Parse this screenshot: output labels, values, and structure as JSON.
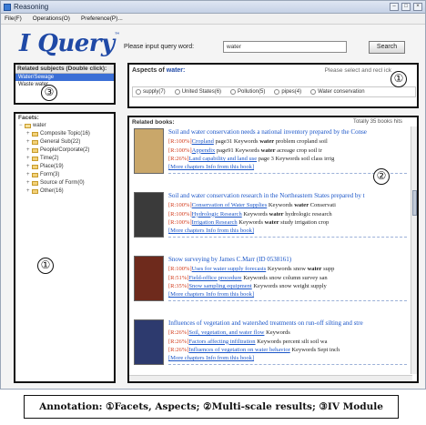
{
  "window": {
    "title": "Reasoning",
    "menu": [
      "File(F)",
      "Operations(O)",
      "Preference(P)..."
    ]
  },
  "header": {
    "logo": "I Query",
    "logo_mark": "™",
    "search_label": "Please input query word:",
    "search_value": "water",
    "search_button": "Search"
  },
  "related": {
    "header": "Related subjects (Double click):",
    "items": [
      "Water/Sewage",
      "Waste water"
    ]
  },
  "facets": {
    "header": "Facets:",
    "root": "water",
    "nodes": [
      "Composite Topic(16)",
      "General Sub(22)",
      "People/Corporate(2)",
      "Time(2)",
      "Place(19)",
      "Form(3)",
      "Source of Form(0)",
      "Other(16)"
    ]
  },
  "aspects": {
    "title_prefix": "Aspects of",
    "keyword": "water:",
    "hint": "Please select and recl ick",
    "options": [
      "supply(7)",
      "United States(6)",
      "Pollution(5)",
      "pipes(4)",
      "Water conservation"
    ]
  },
  "results": {
    "header": "Related books:",
    "count": "Totally 35 books hits",
    "more_label": "[More chapters Info from this book]",
    "books": [
      {
        "title": "Soil and water conservation needs a national inventory prepared by the Conse",
        "cover_color": "#c9a76a",
        "hits": [
          {
            "pct": "[R:100%]",
            "link": "Cropland",
            "text": " page31   Keywords ",
            "kw": "water",
            "rest": "  problem  cropland  soil"
          },
          {
            "pct": "[R:100%]",
            "link": "Appendix",
            "text": " page91   Keywords ",
            "kw": "water",
            "rest": "  acreage  crop  soil  ir"
          },
          {
            "pct": "[R:26%]",
            "link": "Land capability and land use",
            "text": " page 3   Keywords ",
            "kw": "",
            "rest": "soil  class  irrig"
          }
        ]
      },
      {
        "title": "Soil and water conservation research in the Northeastern States prepared by t",
        "cover_color": "#3a3a3a",
        "hits": [
          {
            "pct": "[R:100%]",
            "link": "Conservation of Water Supplies",
            "text": "   Keywords ",
            "kw": "water",
            "rest": "  Conservati"
          },
          {
            "pct": "[R:100%]",
            "link": "Hydrologic Research",
            "text": "   Keywords ",
            "kw": "water",
            "rest": "  hydrologic  research"
          },
          {
            "pct": "[R:100%]",
            "link": "Irrigation Research",
            "text": "   Keywords ",
            "kw": "water",
            "rest": "  study  irrigation  crop"
          }
        ]
      },
      {
        "title": "Snow surveying by James C.Marr (ID 0538161)",
        "cover_color": "#6e2a1c",
        "hits": [
          {
            "pct": "[R:100%]",
            "link": "Uses for water supply forecasts",
            "text": "   Keywords snow ",
            "kw": "water",
            "rest": "  supp"
          },
          {
            "pct": "[R:51%]",
            "link": "Field-office procedure",
            "text": "   Keywords snow  column  survey  san",
            "kw": "",
            "rest": ""
          },
          {
            "pct": "[R:35%]",
            "link": "Snow sampling equipment",
            "text": "   Keywords snow  weight  supply",
            "kw": "",
            "rest": ""
          }
        ]
      },
      {
        "title": "Influences of vegetation and watershed treatments on run-off silting and stre",
        "cover_color": "#2d3a6e",
        "hits": [
          {
            "pct": "[R:26%]",
            "link": "Soil, vegetation, and water flow",
            "text": "   Keywords",
            "kw": "",
            "rest": ""
          },
          {
            "pct": "[R:26%]",
            "link": "Factors affecting infiltration",
            "text": "   Keywords  percent  silt  soil  wa",
            "kw": "",
            "rest": ""
          },
          {
            "pct": "[R:26%]",
            "link": "Influences of vegetation on water behavior",
            "text": "   Keywords Sept  inch",
            "kw": "",
            "rest": ""
          }
        ]
      }
    ]
  },
  "callouts": [
    "①",
    "②",
    "③",
    "①"
  ],
  "caption": "Annotation: ①Facets, Aspects; ②Multi-scale results; ③IV Module"
}
